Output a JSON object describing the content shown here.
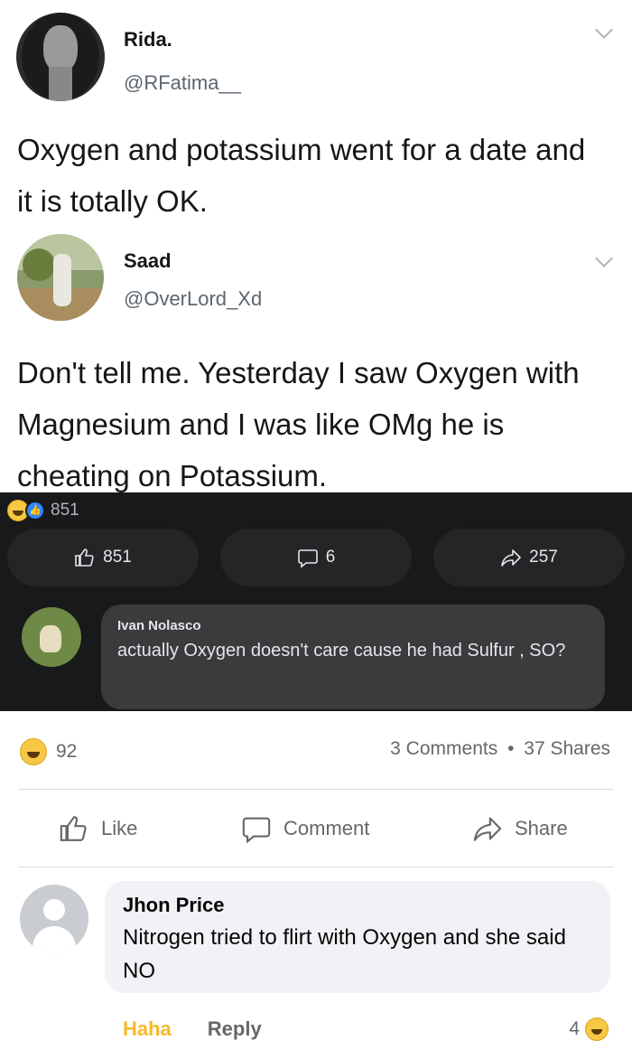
{
  "tweet1": {
    "name": "Rida.",
    "handle": "@RFatima__",
    "text": "Oxygen and potassium went for a date and it is totally OK."
  },
  "tweet2": {
    "name": "Saad",
    "handle": "@OverLord_Xd",
    "text": "Don't tell me. Yesterday I saw Oxygen with Magnesium and I was like OMg he is cheating on Potassium."
  },
  "dark_post": {
    "reaction_count": "851",
    "like_count": "851",
    "comment_count": "6",
    "share_count": "257",
    "comment": {
      "author": "Ivan Nolasco",
      "text": "actually Oxygen doesn't care cause he had Sulfur , SO?"
    }
  },
  "light_post": {
    "reaction_count": "92",
    "comments_label": "3 Comments",
    "separator": "•",
    "shares_label": "37 Shares",
    "actions": {
      "like": "Like",
      "comment": "Comment",
      "share": "Share"
    },
    "comment": {
      "author": "Jhon Price",
      "text": "Nitrogen tried to flirt with Oxygen and she said NO",
      "haha_label": "Haha",
      "reply_label": "Reply",
      "reaction_count": "4"
    }
  },
  "icons": {
    "reaction_primary": "haha-emoji-icon",
    "reaction_secondary": "like-reaction-icon",
    "like": "thumbs-up-icon",
    "comment": "speech-bubble-icon",
    "share": "share-arrow-icon",
    "menu": "chevron-down-icon"
  },
  "colors": {
    "dark_bg": "#18191a",
    "dark_button": "#242526",
    "dark_bubble": "#3a3b3c",
    "haha_yellow": "#f7b928",
    "facebook_blue": "#2d88ff",
    "text_secondary": "#65676b"
  }
}
